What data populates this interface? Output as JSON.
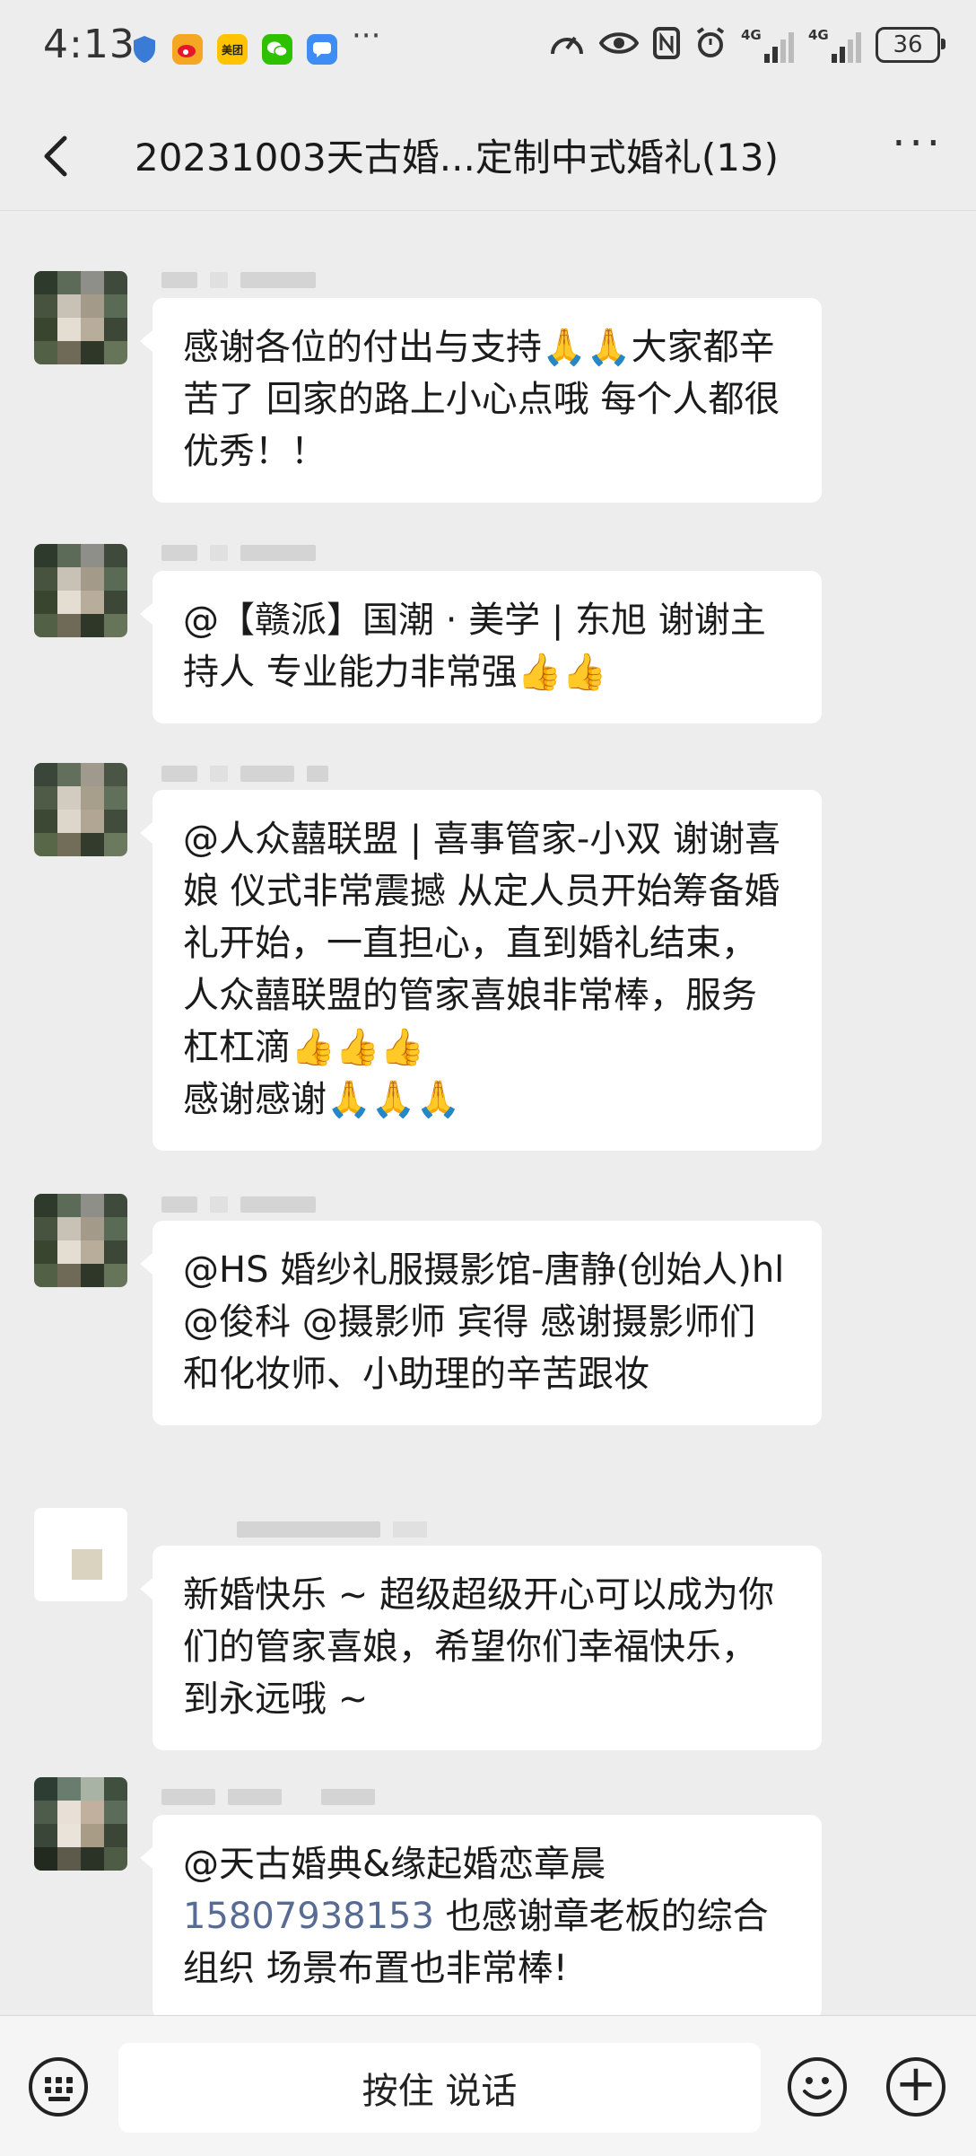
{
  "status_bar": {
    "time": "4:13",
    "more": "···",
    "network_1": "4G",
    "network_2": "4G",
    "battery": "36",
    "icons": [
      "shield-icon",
      "weibo-icon",
      "meituan-icon",
      "wechat-icon",
      "message-icon",
      "speed-icon",
      "eye-icon",
      "nfc-icon",
      "alarm-icon"
    ],
    "meituan_label": "美团"
  },
  "header": {
    "title": "20231003天古婚...定制中式婚礼(13)",
    "more": "···"
  },
  "messages": [
    {
      "id": "m1",
      "text": "感谢各位的付出与支持🙏🙏大家都辛苦了  回家的路上小心点哦  每个人都很优秀！！"
    },
    {
      "id": "m2",
      "text": "@【赣派】国潮 · 美学 | 东旭  谢谢主持人  专业能力非常强👍👍"
    },
    {
      "id": "m3",
      "text": "@人众囍联盟 | 喜事管家-小双    谢谢喜娘  仪式非常震撼 从定人员开始筹备婚礼开始，一直担心，直到婚礼结束，人众囍联盟的管家喜娘非常棒，服务杠杠滴👍👍👍\n感谢感谢🙏🙏🙏"
    },
    {
      "id": "m4",
      "text": "@HS 婚纱礼服摄影馆-唐静(创始人)hl  @俊科  @摄影师 宾得  感谢摄影师们和化妆师、小助理的辛苦跟妆"
    },
    {
      "id": "m5",
      "text": "新婚快乐 ~ 超级超级开心可以成为你们的管家喜娘，希望你们幸福快乐，到永远哦 ~"
    },
    {
      "id": "m6",
      "text_before": "@天古婚典&缘起婚恋章晨",
      "phone": "15807938153",
      "text_after": " 也感谢章老板的综合组织  场景布置也非常棒!"
    }
  ],
  "input_bar": {
    "talk_label": "按住 说话",
    "keyboard_icon": "keyboard-icon",
    "emoji_icon": "emoji-icon",
    "plus_icon": "plus-icon"
  },
  "colors": {
    "background": "#ededed",
    "bubble": "#ffffff",
    "link": "#576b95"
  }
}
